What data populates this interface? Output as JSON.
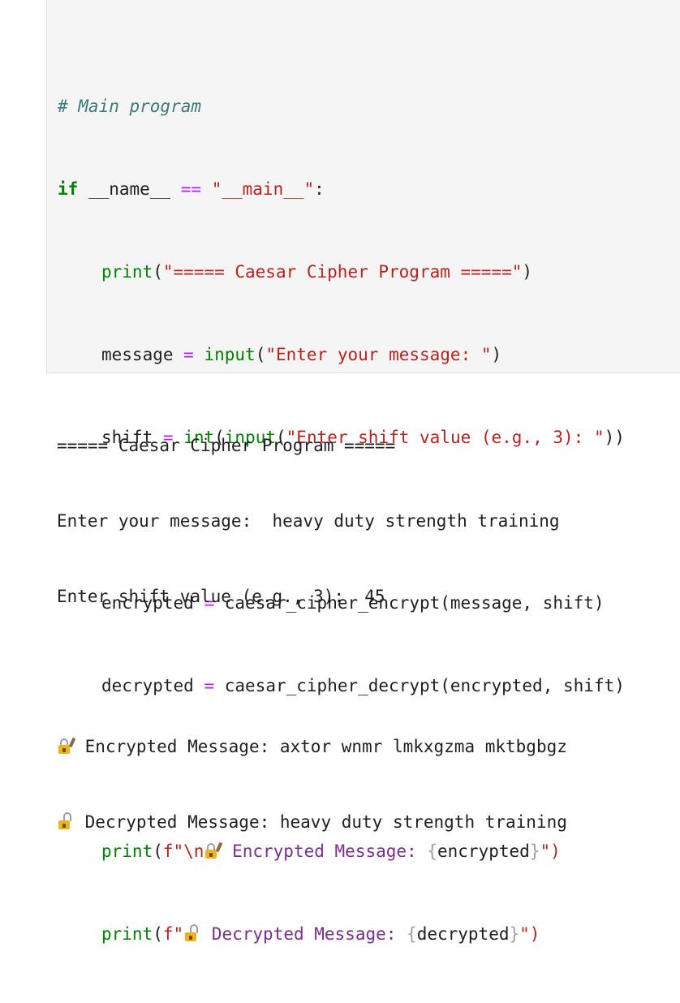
{
  "code": {
    "comment": "# Main program",
    "if_kw": "if",
    "name_var": "__name__",
    "eq_op": "==",
    "main_str": "\"__main__\"",
    "colon": ":",
    "print1": {
      "fn": "print",
      "open": "(",
      "str": "\"===== Caesar Cipher Program =====\"",
      "close": ")"
    },
    "message_line": {
      "var": "message",
      "eq": "=",
      "fn": "input",
      "open": "(",
      "str": "\"Enter your message: \"",
      "close": ")"
    },
    "shift_line": {
      "var": "shift",
      "eq": "=",
      "fn1": "int",
      "open1": "(",
      "fn2": "input",
      "open2": "(",
      "str": "\"Enter shift value (e.g., 3): \"",
      "close": "))"
    },
    "encrypted_line": {
      "var": "encrypted",
      "eq": "=",
      "call": "caesar_cipher_encrypt(message, shift)"
    },
    "decrypted_line": {
      "var": "decrypted",
      "eq": "=",
      "call": "caesar_cipher_decrypt(encrypted, shift)"
    },
    "print2": {
      "fn": "print",
      "open": "(",
      "prefix": "f\"\\n",
      "label": " Encrypted Message: ",
      "lbrace": "{",
      "expr": "encrypted",
      "rbrace": "}",
      "end": "\")"
    },
    "print3": {
      "fn": "print",
      "open": "(",
      "prefix": "f\"",
      "label": " Decrypted Message: ",
      "lbrace": "{",
      "expr": "decrypted",
      "rbrace": "}",
      "end": "\")"
    }
  },
  "output": {
    "line1": "===== Caesar Cipher Program =====",
    "line2": "Enter your message:  heavy duty strength training",
    "line3": "Enter shift value (e.g., 3):  45",
    "line4": "Encrypted Message: axtor wnmr lmkxgzma mktbgbgz",
    "line5": "Decrypted Message: heavy duty strength training"
  },
  "icons": {
    "encrypted": "locked-with-pen-icon",
    "decrypted": "unlocked-icon"
  },
  "colors": {
    "comment": "#3d7b7b",
    "keyword": "#008000",
    "string": "#ba2121",
    "operator": "#aa22ff",
    "lock": "#f2b21b"
  }
}
